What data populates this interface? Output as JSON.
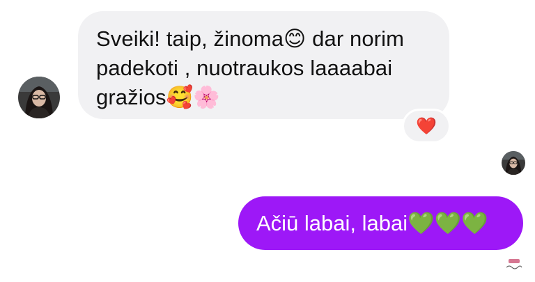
{
  "conversation": {
    "incoming": {
      "lines": [
        "Sveiki! taip, žinoma😊 dar norim",
        "padekoti , nuotraukos laaaabai",
        "gražios🥰🌸"
      ],
      "reaction": "❤️"
    },
    "outgoing": {
      "text": "Ačiū labai, labai💚💚💚"
    }
  },
  "icons": {
    "sender_avatar": "avatar",
    "seen_avatar": "avatar",
    "watermark": "logo-watermark"
  },
  "colors": {
    "incoming_bubble": "#f1f1f3",
    "outgoing_bubble": "#9d18f7",
    "reaction_heart": "#e5182c"
  }
}
